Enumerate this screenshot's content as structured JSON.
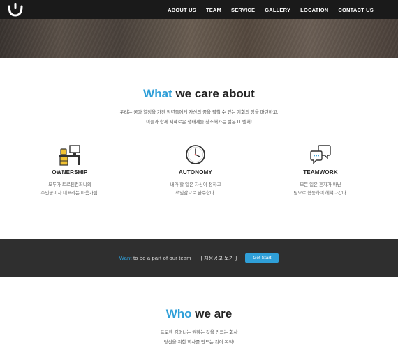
{
  "nav": {
    "items": [
      {
        "label": "ABOUT US"
      },
      {
        "label": "TEAM"
      },
      {
        "label": "SERVICE"
      },
      {
        "label": "GALLERY"
      },
      {
        "label": "LOCATION"
      },
      {
        "label": "CONTACT US"
      }
    ]
  },
  "about": {
    "title_accent": "What",
    "title_rest": " we care about",
    "intro_line1": "우리는 꿈과 열정을 가진 청년들에게 자신의 꿈을 펼칠 수 있는 기회의 장을 마련하고,",
    "intro_line2": "이들과 함께 지혜로운 생태계를 창조해가는 젊은 IT 벤처!",
    "features": [
      {
        "icon": "desk-icon",
        "title": "OWNERSHIP",
        "desc1": "모두가 트로젠컴퍼니의",
        "desc2": "주인공이자 대표라는 마음가짐."
      },
      {
        "icon": "clock-icon",
        "title": "AUTONOMY",
        "desc1": "내가 할 일은 자신이 정하고",
        "desc2": "책임감으로 완수한다."
      },
      {
        "icon": "chat-bubbles-icon",
        "title": "TEAMWORK",
        "desc1": "모든 일은 혼자가 아닌",
        "desc2": "팀으로 협동하여 헤쳐나간다."
      }
    ]
  },
  "cta": {
    "text_accent": "Want",
    "text_rest": " to be a part of our team",
    "link_label": "[ 채용공고 보기 ]",
    "button_label": "Get Start"
  },
  "who": {
    "title_accent": "Who",
    "title_rest": " we are",
    "line1": "트로젠 컴퍼니는 원하는 것을 만드는 회사",
    "line2": "당신을 위한 회사를 만드는 것이 목적!"
  },
  "colors": {
    "accent": "#2f9fd8",
    "navbar": "#1a1a1a",
    "cta_band": "#2f2f2f"
  }
}
